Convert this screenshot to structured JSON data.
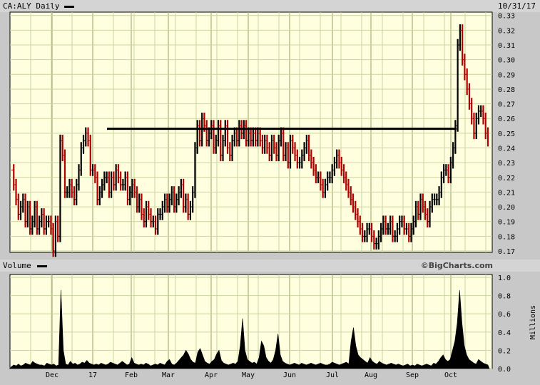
{
  "header": {
    "symbol_label": "CA:ALY Daily",
    "date": "10/31/17",
    "volume_label": "Volume",
    "watermark": "©BigCharts.com"
  },
  "colors": {
    "plot_bg": "#ffffe0",
    "grid": "#c8d4a0",
    "up": "#000000",
    "down": "#b00000",
    "month_line": "#a8b078"
  },
  "chart_data": [
    {
      "type": "line",
      "title": "CA:ALY Daily",
      "x_ticks": [
        "Dec",
        "17",
        "Feb",
        "Mar",
        "Apr",
        "May",
        "Jun",
        "Jul",
        "Aug",
        "Sep",
        "Oct"
      ],
      "ylim": [
        0.17,
        0.33
      ],
      "y_ticks": [
        "0.33",
        "0.32",
        "0.31",
        "0.30",
        "0.29",
        "0.28",
        "0.27",
        "0.26",
        "0.25",
        "0.24",
        "0.23",
        "0.22",
        "0.21",
        "0.20",
        "0.19",
        "0.18",
        "0.17"
      ],
      "resistance_level": 0.253,
      "series": [
        {
          "values": [
            0.225,
            0.215,
            0.205,
            0.195,
            0.2,
            0.205,
            0.19,
            0.2,
            0.185,
            0.19,
            0.2,
            0.185,
            0.19,
            0.195,
            0.185,
            0.19,
            0.19,
            0.185,
            0.17,
            0.19,
            0.18,
            0.245,
            0.235,
            0.21,
            0.21,
            0.215,
            0.21,
            0.205,
            0.215,
            0.225,
            0.24,
            0.245,
            0.25,
            0.245,
            0.225,
            0.225,
            0.22,
            0.205,
            0.21,
            0.215,
            0.22,
            0.22,
            0.21,
            0.22,
            0.215,
            0.225,
            0.22,
            0.215,
            0.215,
            0.22,
            0.205,
            0.21,
            0.215,
            0.21,
            0.2,
            0.205,
            0.195,
            0.19,
            0.2,
            0.195,
            0.19,
            0.19,
            0.185,
            0.195,
            0.195,
            0.2,
            0.205,
            0.2,
            0.205,
            0.21,
            0.2,
            0.205,
            0.21,
            0.215,
            0.2,
            0.205,
            0.195,
            0.2,
            0.21,
            0.24,
            0.255,
            0.245,
            0.26,
            0.255,
            0.245,
            0.25,
            0.255,
            0.24,
            0.245,
            0.255,
            0.235,
            0.245,
            0.255,
            0.24,
            0.235,
            0.245,
            0.25,
            0.245,
            0.255,
            0.25,
            0.255,
            0.245,
            0.25,
            0.245,
            0.25,
            0.245,
            0.25,
            0.245,
            0.24,
            0.245,
            0.24,
            0.235,
            0.245,
            0.24,
            0.235,
            0.245,
            0.25,
            0.235,
            0.24,
            0.23,
            0.245,
            0.24,
            0.235,
            0.23,
            0.23,
            0.235,
            0.24,
            0.245,
            0.235,
            0.23,
            0.225,
            0.22,
            0.22,
            0.215,
            0.21,
            0.215,
            0.22,
            0.22,
            0.225,
            0.23,
            0.235,
            0.23,
            0.225,
            0.22,
            0.215,
            0.21,
            0.205,
            0.2,
            0.195,
            0.19,
            0.185,
            0.18,
            0.18,
            0.185,
            0.185,
            0.18,
            0.175,
            0.175,
            0.18,
            0.185,
            0.19,
            0.185,
            0.185,
            0.19,
            0.18,
            0.18,
            0.185,
            0.19,
            0.19,
            0.185,
            0.185,
            0.18,
            0.185,
            0.19,
            0.2,
            0.195,
            0.205,
            0.2,
            0.195,
            0.19,
            0.2,
            0.205,
            0.205,
            0.205,
            0.21,
            0.22,
            0.225,
            0.225,
            0.22,
            0.23,
            0.24,
            0.255,
            0.31,
            0.32,
            0.3,
            0.29,
            0.28,
            0.27,
            0.26,
            0.25,
            0.26,
            0.265,
            0.265,
            0.26,
            0.25,
            0.245
          ]
        },
        {
          "name": "Volume",
          "unit": "Millions",
          "ylim": [
            0,
            1.0
          ],
          "y_ticks": [
            "1.0",
            "0.8",
            "0.6",
            "0.4",
            "0.2",
            "0.0"
          ],
          "values": [
            0.02,
            0.04,
            0.03,
            0.05,
            0.03,
            0.04,
            0.06,
            0.05,
            0.04,
            0.08,
            0.06,
            0.05,
            0.04,
            0.04,
            0.03,
            0.06,
            0.05,
            0.04,
            0.05,
            0.03,
            0.04,
            0.86,
            0.2,
            0.05,
            0.04,
            0.08,
            0.05,
            0.06,
            0.04,
            0.05,
            0.07,
            0.06,
            0.09,
            0.06,
            0.05,
            0.04,
            0.05,
            0.04,
            0.06,
            0.05,
            0.04,
            0.05,
            0.07,
            0.06,
            0.05,
            0.04,
            0.06,
            0.08,
            0.06,
            0.04,
            0.05,
            0.12,
            0.06,
            0.05,
            0.04,
            0.05,
            0.04,
            0.06,
            0.05,
            0.03,
            0.04,
            0.05,
            0.04,
            0.06,
            0.05,
            0.04,
            0.08,
            0.1,
            0.05,
            0.04,
            0.06,
            0.09,
            0.12,
            0.15,
            0.2,
            0.16,
            0.1,
            0.07,
            0.06,
            0.18,
            0.22,
            0.15,
            0.08,
            0.06,
            0.05,
            0.08,
            0.1,
            0.16,
            0.2,
            0.09,
            0.06,
            0.05,
            0.04,
            0.05,
            0.06,
            0.05,
            0.08,
            0.25,
            0.55,
            0.2,
            0.1,
            0.08,
            0.06,
            0.07,
            0.05,
            0.12,
            0.3,
            0.25,
            0.12,
            0.08,
            0.06,
            0.1,
            0.2,
            0.38,
            0.15,
            0.08,
            0.06,
            0.05,
            0.04,
            0.05,
            0.06,
            0.05,
            0.04,
            0.06,
            0.05,
            0.04,
            0.05,
            0.06,
            0.05,
            0.04,
            0.05,
            0.06,
            0.05,
            0.04,
            0.04,
            0.05,
            0.07,
            0.06,
            0.05,
            0.04,
            0.05,
            0.06,
            0.07,
            0.05,
            0.3,
            0.45,
            0.25,
            0.15,
            0.12,
            0.1,
            0.08,
            0.06,
            0.12,
            0.08,
            0.06,
            0.05,
            0.08,
            0.06,
            0.05,
            0.04,
            0.05,
            0.06,
            0.05,
            0.04,
            0.05,
            0.04,
            0.03,
            0.04,
            0.05,
            0.03,
            0.04,
            0.03,
            0.05,
            0.04,
            0.03,
            0.04,
            0.05,
            0.04,
            0.03,
            0.06,
            0.05,
            0.08,
            0.12,
            0.15,
            0.1,
            0.08,
            0.1,
            0.2,
            0.3,
            0.5,
            0.86,
            0.5,
            0.25,
            0.15,
            0.1,
            0.08,
            0.06,
            0.05,
            0.1,
            0.08,
            0.06,
            0.05,
            0.04
          ]
        }
      ]
    }
  ]
}
